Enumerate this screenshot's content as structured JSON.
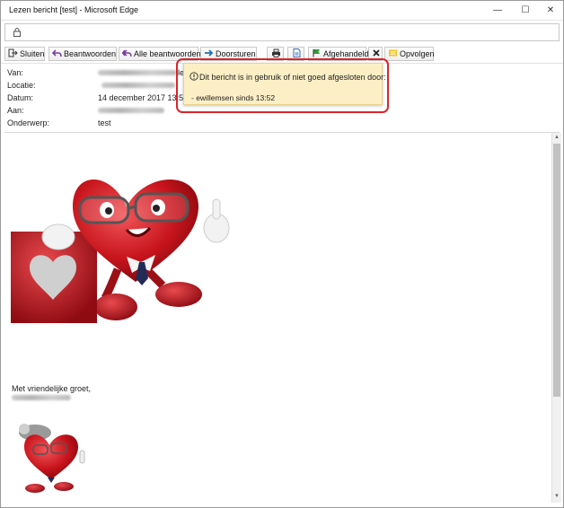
{
  "window": {
    "title": "Lezen bericht [test] - Microsoft Edge",
    "minimize": "—",
    "maximize": "☐",
    "close": "✕"
  },
  "toolbar": {
    "close_label": "Sluiten",
    "reply_label": "Beantwoorden",
    "reply_all_label": "Alle beantwoorden",
    "forward_label": "Doorsturen",
    "handled_label": "Afgehandeld",
    "followup_label": "Opvolgen"
  },
  "header": {
    "from_label": "Van:",
    "location_label": "Locatie:",
    "date_label": "Datum:",
    "date_value": "14 december 2017 13:50",
    "to_label": "Aan:",
    "subject_label": "Onderwerp:",
    "subject_value": "test",
    "from_suffix": "le"
  },
  "notice": {
    "message": "Dit bericht is in gebruik of niet goed afgesloten door:",
    "user_line": "- ewillemsen sinds 13:52"
  },
  "body": {
    "signoff": "Met vriendelijke groet,"
  },
  "colors": {
    "accent_red": "#d9262b",
    "notice_bg": "#fcefc6",
    "heart_red": "#c8141c"
  }
}
